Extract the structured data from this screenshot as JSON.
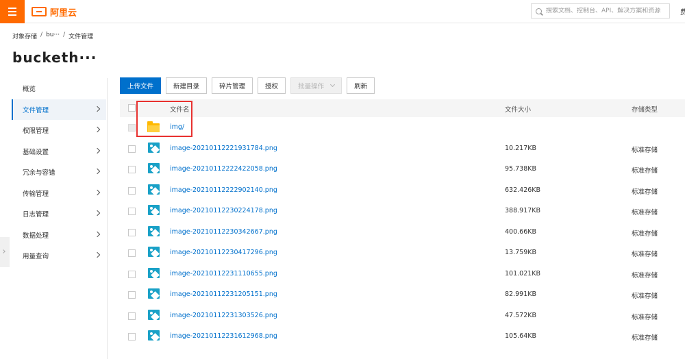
{
  "topbar": {
    "logo_text": "阿里云",
    "search_placeholder": "搜索文档、控制台、API、解决方案和资源",
    "right_cut_text": "费"
  },
  "breadcrumb": [
    "对象存储",
    "bu···",
    "文件管理"
  ],
  "bucket_title": "bucketh···",
  "sidebar": {
    "items": [
      {
        "label": "概览",
        "chevron": false,
        "active": false
      },
      {
        "label": "文件管理",
        "chevron": true,
        "active": true
      },
      {
        "label": "权限管理",
        "chevron": true,
        "active": false
      },
      {
        "label": "基础设置",
        "chevron": true,
        "active": false
      },
      {
        "label": "冗余与容错",
        "chevron": true,
        "active": false
      },
      {
        "label": "传输管理",
        "chevron": true,
        "active": false
      },
      {
        "label": "日志管理",
        "chevron": true,
        "active": false
      },
      {
        "label": "数据处理",
        "chevron": true,
        "active": false
      },
      {
        "label": "用量查询",
        "chevron": true,
        "active": false
      }
    ]
  },
  "toolbar": {
    "upload": "上传文件",
    "new_dir": "新建目录",
    "fragments": "碎片管理",
    "authorize": "授权",
    "batch": "批量操作",
    "refresh": "刷新"
  },
  "table": {
    "headers": {
      "name": "文件名",
      "size": "文件大小",
      "storage_class": "存储类型"
    },
    "rows": [
      {
        "type": "folder",
        "name": "img/",
        "size": "",
        "storage_class": ""
      },
      {
        "type": "image",
        "name": "image-20210112221931784.png",
        "size": "10.217KB",
        "storage_class": "标准存储"
      },
      {
        "type": "image",
        "name": "image-20210112222422058.png",
        "size": "95.738KB",
        "storage_class": "标准存储"
      },
      {
        "type": "image",
        "name": "image-20210112222902140.png",
        "size": "632.426KB",
        "storage_class": "标准存储"
      },
      {
        "type": "image",
        "name": "image-20210112230224178.png",
        "size": "388.917KB",
        "storage_class": "标准存储"
      },
      {
        "type": "image",
        "name": "image-20210112230342667.png",
        "size": "400.66KB",
        "storage_class": "标准存储"
      },
      {
        "type": "image",
        "name": "image-20210112230417296.png",
        "size": "13.759KB",
        "storage_class": "标准存储"
      },
      {
        "type": "image",
        "name": "image-20210112231110655.png",
        "size": "101.021KB",
        "storage_class": "标准存储"
      },
      {
        "type": "image",
        "name": "image-20210112231205151.png",
        "size": "82.991KB",
        "storage_class": "标准存储"
      },
      {
        "type": "image",
        "name": "image-20210112231303526.png",
        "size": "47.572KB",
        "storage_class": "标准存储"
      },
      {
        "type": "image",
        "name": "image-20210112231612968.png",
        "size": "105.64KB",
        "storage_class": "标准存储"
      }
    ]
  },
  "colors": {
    "brand": "#ff6a00",
    "link": "#0070cc",
    "highlight": "#e8312f"
  }
}
